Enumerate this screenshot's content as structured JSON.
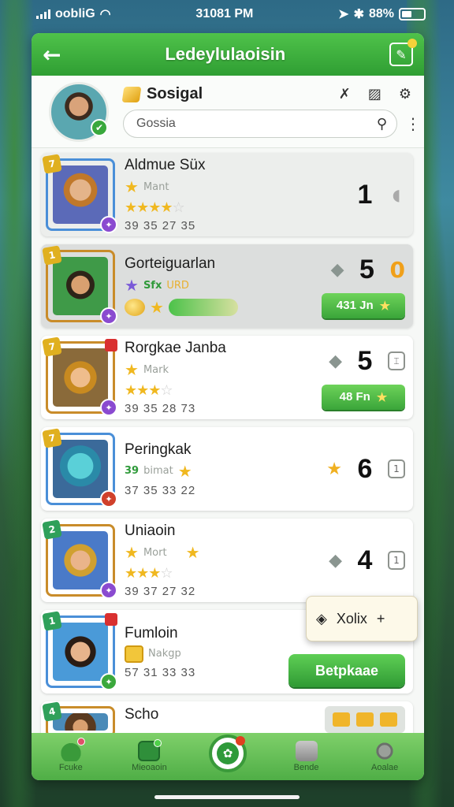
{
  "status_bar": {
    "carrier": "oobliG",
    "time": "31081 PM",
    "battery": "88%"
  },
  "header": {
    "title": "Ledeylulaoisin"
  },
  "profile": {
    "name": "Sosigal",
    "search_value": "Gossia"
  },
  "players": [
    {
      "name": "Aldmue Süx",
      "sub": "Mant",
      "stars": 4.5,
      "stats": "39 35 27 35",
      "rank": "1"
    },
    {
      "name": "Gorteiguarlan",
      "sub_a": "Sfx",
      "sub_b": "URD",
      "rank": "5",
      "value": "0",
      "button": "431 Jn"
    },
    {
      "name": "Rorgkae Janba",
      "sub": "Mark",
      "stars": 3,
      "stats": "39 35 28 73",
      "rank": "5",
      "button": "48 Fn"
    },
    {
      "name": "Peringkak",
      "sub_a": "39",
      "sub_b": "bimat",
      "stats": "37 35 33 22",
      "rank": "6"
    },
    {
      "name": "Uniaoin",
      "sub": "Mort",
      "stars": 3,
      "stats": "39 37 27 32",
      "rank": "4"
    },
    {
      "name": "Fumloin",
      "sub": "Nakgp",
      "stats": "57 31 33 33"
    },
    {
      "name": "Scho"
    }
  ],
  "popover": {
    "label": "Xolix",
    "plus": "+"
  },
  "actions": {
    "big_button": "Betpkaae"
  },
  "nav": [
    {
      "label": "Fcuke"
    },
    {
      "label": "Mieoaoin"
    },
    {
      "label": ""
    },
    {
      "label": "Bende"
    },
    {
      "label": "Aoalae"
    }
  ]
}
